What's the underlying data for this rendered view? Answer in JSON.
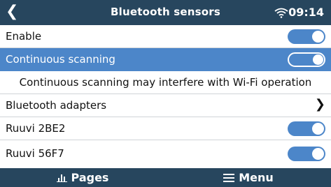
{
  "header": {
    "title": "Bluetooth sensors",
    "back_icon": "back-arrow-icon",
    "wifi_icon": "wifi-icon",
    "time": "09:14"
  },
  "settings": [
    {
      "label": "Enable",
      "toggle_on": true,
      "selected": false
    },
    {
      "label": "Continuous scanning",
      "toggle_on": true,
      "selected": true
    },
    {
      "note": "Continuous scanning may interfere with Wi-Fi operation"
    },
    {
      "label": "Bluetooth adapters",
      "chevron_icon": "chevron-right-icon"
    },
    {
      "label": "Ruuvi 2BE2",
      "toggle_on": true
    },
    {
      "label": "Ruuvi 56F7",
      "toggle_on": true
    }
  ],
  "footer": {
    "pages_label": "Pages",
    "pages_icon": "bar-chart-icon",
    "menu_label": "Menu",
    "menu_icon": "hamburger-menu-icon"
  },
  "colors": {
    "header_bg": "#27465e",
    "accent": "#4c86c9",
    "row_divider": "#d0d4d8"
  }
}
